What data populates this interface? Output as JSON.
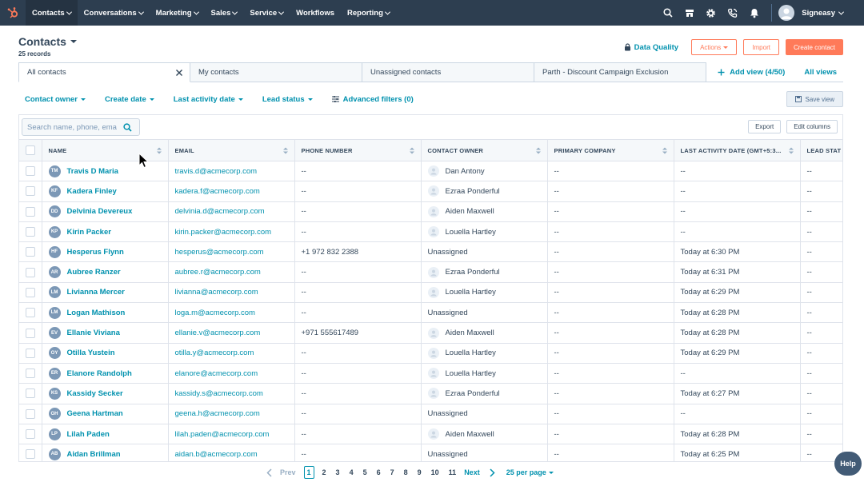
{
  "nav": {
    "items": [
      {
        "label": "Contacts",
        "active": true,
        "caret": true
      },
      {
        "label": "Conversations",
        "caret": true
      },
      {
        "label": "Marketing",
        "caret": true
      },
      {
        "label": "Sales",
        "caret": true
      },
      {
        "label": "Service",
        "caret": true
      },
      {
        "label": "Workflows",
        "caret": false
      },
      {
        "label": "Reporting",
        "caret": true
      }
    ],
    "account_name": "Signeasy"
  },
  "header": {
    "title": "Contacts",
    "record_count": "25 records",
    "data_quality": "Data Quality",
    "actions": "Actions",
    "import": "Import",
    "create": "Create contact"
  },
  "tabs": {
    "items": [
      "All contacts",
      "My contacts",
      "Unassigned contacts",
      "Parth - Discount Campaign Exclusion"
    ],
    "add_view": "Add view (4/50)",
    "all_views": "All views"
  },
  "filters": {
    "items": [
      "Contact owner",
      "Create date",
      "Last activity date",
      "Lead status"
    ],
    "advanced": "Advanced filters (0)",
    "save_view": "Save view"
  },
  "toolbar": {
    "search_placeholder": "Search name, phone, email",
    "export": "Export",
    "edit_columns": "Edit columns"
  },
  "columns": [
    "NAME",
    "EMAIL",
    "PHONE NUMBER",
    "CONTACT OWNER",
    "PRIMARY COMPANY",
    "LAST ACTIVITY DATE (GMT+5:3...",
    "LEAD STAT"
  ],
  "rows": [
    {
      "initials": "TM",
      "name": "Travis D Maria",
      "email": "travis.d@acmecorp.com",
      "phone": "--",
      "owner": "Dan Antony",
      "company": "--",
      "last_activity": "--",
      "lead": "--"
    },
    {
      "initials": "KF",
      "name": "Kadera Finley",
      "email": "kadera.f@acmecorp.com",
      "phone": "--",
      "owner": "Ezraa Ponderful",
      "company": "--",
      "last_activity": "--",
      "lead": "--"
    },
    {
      "initials": "DD",
      "name": "Delvinia Devereux",
      "email": "delvinia.d@acmecorp.com",
      "phone": "--",
      "owner": "Aiden Maxwell",
      "company": "--",
      "last_activity": "--",
      "lead": "--"
    },
    {
      "initials": "KP",
      "name": "Kirin Packer",
      "email": "kirin.packer@acmecorp.com",
      "phone": "--",
      "owner": "Louella Hartley",
      "company": "--",
      "last_activity": "--",
      "lead": "--"
    },
    {
      "initials": "HF",
      "name": "Hesperus Flynn",
      "email": "hesperus@acmecorp.com",
      "phone": "+1 972 832 2388",
      "owner": "Unassigned",
      "company": "--",
      "last_activity": "Today at 6:30 PM",
      "lead": "--"
    },
    {
      "initials": "AR",
      "name": "Aubree Ranzer",
      "email": "aubree.r@acmecorp.com",
      "phone": "--",
      "owner": "Ezraa Ponderful",
      "company": "--",
      "last_activity": "Today at 6:31 PM",
      "lead": "--"
    },
    {
      "initials": "LM",
      "name": "Livianna Mercer",
      "email": "livianna@acmecorp.com",
      "phone": "--",
      "owner": "Louella Hartley",
      "company": "--",
      "last_activity": "Today at 6:29 PM",
      "lead": "--"
    },
    {
      "initials": "LM",
      "name": "Logan Mathison",
      "email": "loga.m@acmecorp.com",
      "phone": "--",
      "owner": "Unassigned",
      "company": "--",
      "last_activity": "Today at 6:28 PM",
      "lead": "--"
    },
    {
      "initials": "EV",
      "name": "Ellanie Viviana",
      "email": "ellanie.v@acmecorp.com",
      "phone": "+971 555617489",
      "owner": "Aiden Maxwell",
      "company": "--",
      "last_activity": "Today at 6:28 PM",
      "lead": "--"
    },
    {
      "initials": "OY",
      "name": "Otilla Yustein",
      "email": "otilla.y@acmecorp.com",
      "phone": "--",
      "owner": "Louella Hartley",
      "company": "--",
      "last_activity": "Today at 6:29 PM",
      "lead": "--"
    },
    {
      "initials": "ER",
      "name": "Elanore Randolph",
      "email": "elanore@acmecorp.com",
      "phone": "--",
      "owner": "Louella Hartley",
      "company": "--",
      "last_activity": "--",
      "lead": "--"
    },
    {
      "initials": "KS",
      "name": "Kassidy Secker",
      "email": "kassidy.s@acmecorp.com",
      "phone": "--",
      "owner": "Ezraa Ponderful",
      "company": "--",
      "last_activity": "Today at 6:27 PM",
      "lead": "--"
    },
    {
      "initials": "GH",
      "name": "Geena Hartman",
      "email": "geena.h@acmecorp.com",
      "phone": "--",
      "owner": "Unassigned",
      "company": "--",
      "last_activity": "--",
      "lead": "--"
    },
    {
      "initials": "LP",
      "name": "Lilah Paden",
      "email": "lilah.paden@acmecorp.com",
      "phone": "--",
      "owner": "Aiden Maxwell",
      "company": "--",
      "last_activity": "Today at 6:28 PM",
      "lead": "--"
    },
    {
      "initials": "AB",
      "name": "Aidan Brillman",
      "email": "aidan.b@acmecorp.com",
      "phone": "--",
      "owner": "Unassigned",
      "company": "--",
      "last_activity": "Today at 6:25 PM",
      "lead": "--"
    }
  ],
  "pagination": {
    "prev": "Prev",
    "current": "1",
    "pages": [
      "2",
      "3",
      "4",
      "5",
      "6",
      "7",
      "8",
      "9",
      "10",
      "11"
    ],
    "next": "Next",
    "per_page": "25 per page"
  },
  "help": "Help",
  "colors": {
    "nav_bg": "#2d3e50",
    "accent": "#0091ae",
    "orange": "#ff7a59",
    "text": "#33475b"
  }
}
